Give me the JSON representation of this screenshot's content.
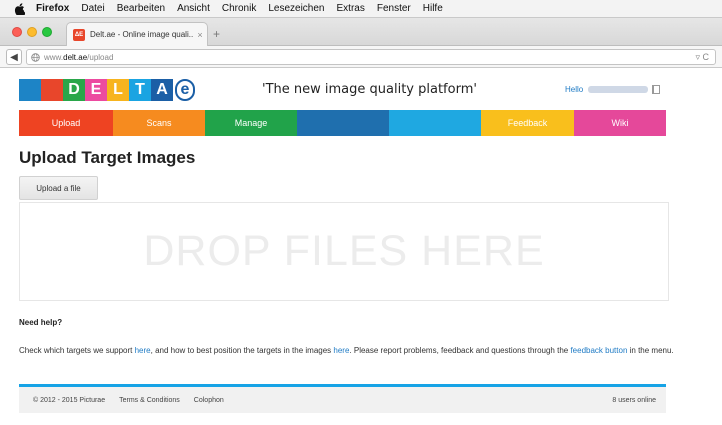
{
  "os_menubar": {
    "app": "Firefox",
    "items": [
      "Datei",
      "Bearbeiten",
      "Ansicht",
      "Chronik",
      "Lesezeichen",
      "Extras",
      "Fenster",
      "Hilfe"
    ]
  },
  "browser": {
    "tab_title": "Delt.ae - Online image quali...",
    "tab_favicon_text": "ΔE",
    "tab_close": "×",
    "new_tab": "+",
    "url_prefix": "www.",
    "url_domain": "delt.ae",
    "url_path": "/upload",
    "reload_glyph": "▿ C"
  },
  "site": {
    "logo_letters": [
      {
        "ch": "",
        "color": "#1d84c6"
      },
      {
        "ch": "",
        "color": "#e8462b"
      },
      {
        "ch": "D",
        "color": "#2aa64a"
      },
      {
        "ch": "E",
        "color": "#ec4aa0"
      },
      {
        "ch": "L",
        "color": "#f7b41e"
      },
      {
        "ch": "T",
        "color": "#1aa4e2"
      },
      {
        "ch": "A",
        "color": "#1b5fa6"
      },
      {
        "ch": "e",
        "color": "#1b5fa6"
      }
    ],
    "tagline": "'The new image quality platform'",
    "hello": "Hello",
    "nav": [
      {
        "label": "Upload",
        "color": "#ee4322"
      },
      {
        "label": "Scans",
        "color": "#f68b1f"
      },
      {
        "label": "Manage",
        "color": "#21a34a"
      },
      {
        "label": "",
        "color": "#1f6fae"
      },
      {
        "label": "",
        "color": "#1fa8e1"
      },
      {
        "label": "Feedback",
        "color": "#f9bf1c"
      },
      {
        "label": "Wiki",
        "color": "#e5489a"
      }
    ]
  },
  "main": {
    "title": "Upload Target Images",
    "upload_button": "Upload a file",
    "dropzone": "DROP FILES HERE",
    "help_heading": "Need help?",
    "help": {
      "t1": "Check which targets we support ",
      "link1": "here",
      "t2": ", and how to best position the targets in the images ",
      "link2": "here",
      "t3": ". Please report problems, feedback and questions through the ",
      "link3": "feedback button",
      "t4": " in the menu."
    }
  },
  "footer": {
    "copyright": "© 2012 - 2015 Picturae",
    "terms": "Terms & Conditions",
    "colophon": "Colophon",
    "online": "8 users online"
  }
}
